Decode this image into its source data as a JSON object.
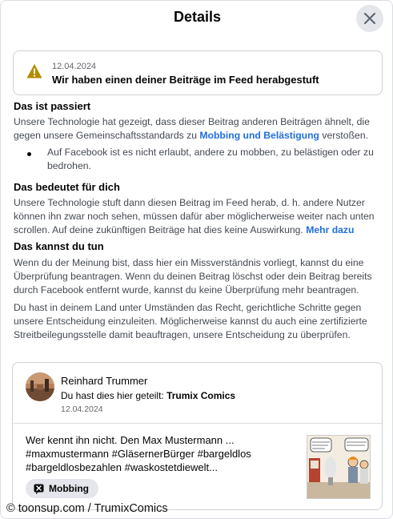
{
  "header": {
    "title": "Details"
  },
  "alert": {
    "date": "12.04.2024",
    "message": "Wir haben einen deiner Beiträge im Feed herabgestuft"
  },
  "section1": {
    "heading": "Das ist passiert",
    "text_before_link": "Unsere Technologie hat gezeigt, dass dieser Beitrag anderen Beiträgen ähnelt, die gegen unsere Gemeinschaftsstandards zu ",
    "link": "Mobbing und Belästigung",
    "text_after_link": " verstoßen.",
    "bullet": "Auf Facebook ist es nicht erlaubt, andere zu mobben, zu belästigen oder zu bedrohen."
  },
  "section2": {
    "heading": "Das bedeutet für dich",
    "text": "Unsere Technologie stuft dann diesen Beitrag im Feed herab, d. h. andere Nutzer können ihn zwar noch sehen, müssen dafür aber möglicherweise weiter nach unten scrollen. Auf deine zukünftigen Beiträge hat dies keine Auswirkung.",
    "link": "Mehr dazu"
  },
  "section3": {
    "heading": "Das kannst du tun",
    "paragraph1": "Wenn du der Meinung bist, dass hier ein Missverständnis vorliegt, kannst du eine Überprüfung beantragen. Wenn du deinen Beitrag löschst oder dein Beitrag bereits durch Facebook entfernt wurde, kannst du keine Überprüfung mehr beantragen.",
    "paragraph2": "Du hast in deinem Land unter Umständen das Recht, gerichtliche Schritte gegen unsere Entscheidung einzuleiten. Möglicherweise kannst du auch eine zertifizierte Streitbeilegungsstelle damit beauftragen, unsere Entscheidung zu überprüfen."
  },
  "post": {
    "author": "Reinhard Trummer",
    "shared_prefix": "Du hast dies hier geteilt: ",
    "shared_page": "Trumix Comics",
    "date": "12.04.2024",
    "text": "Wer kennt ihn nicht. Den Max Mustermann ... #maxmustermann #GläsernerBürger #bargeldlos #bargeldlosbezahlen #waskostetdiewelt...",
    "tag": "Mobbing"
  },
  "watermark": "© toonsup.com / TrumixComics",
  "colors": {
    "link": "#216fdb",
    "warning": "#b58b00",
    "chip_bg": "#e4e6eb"
  }
}
